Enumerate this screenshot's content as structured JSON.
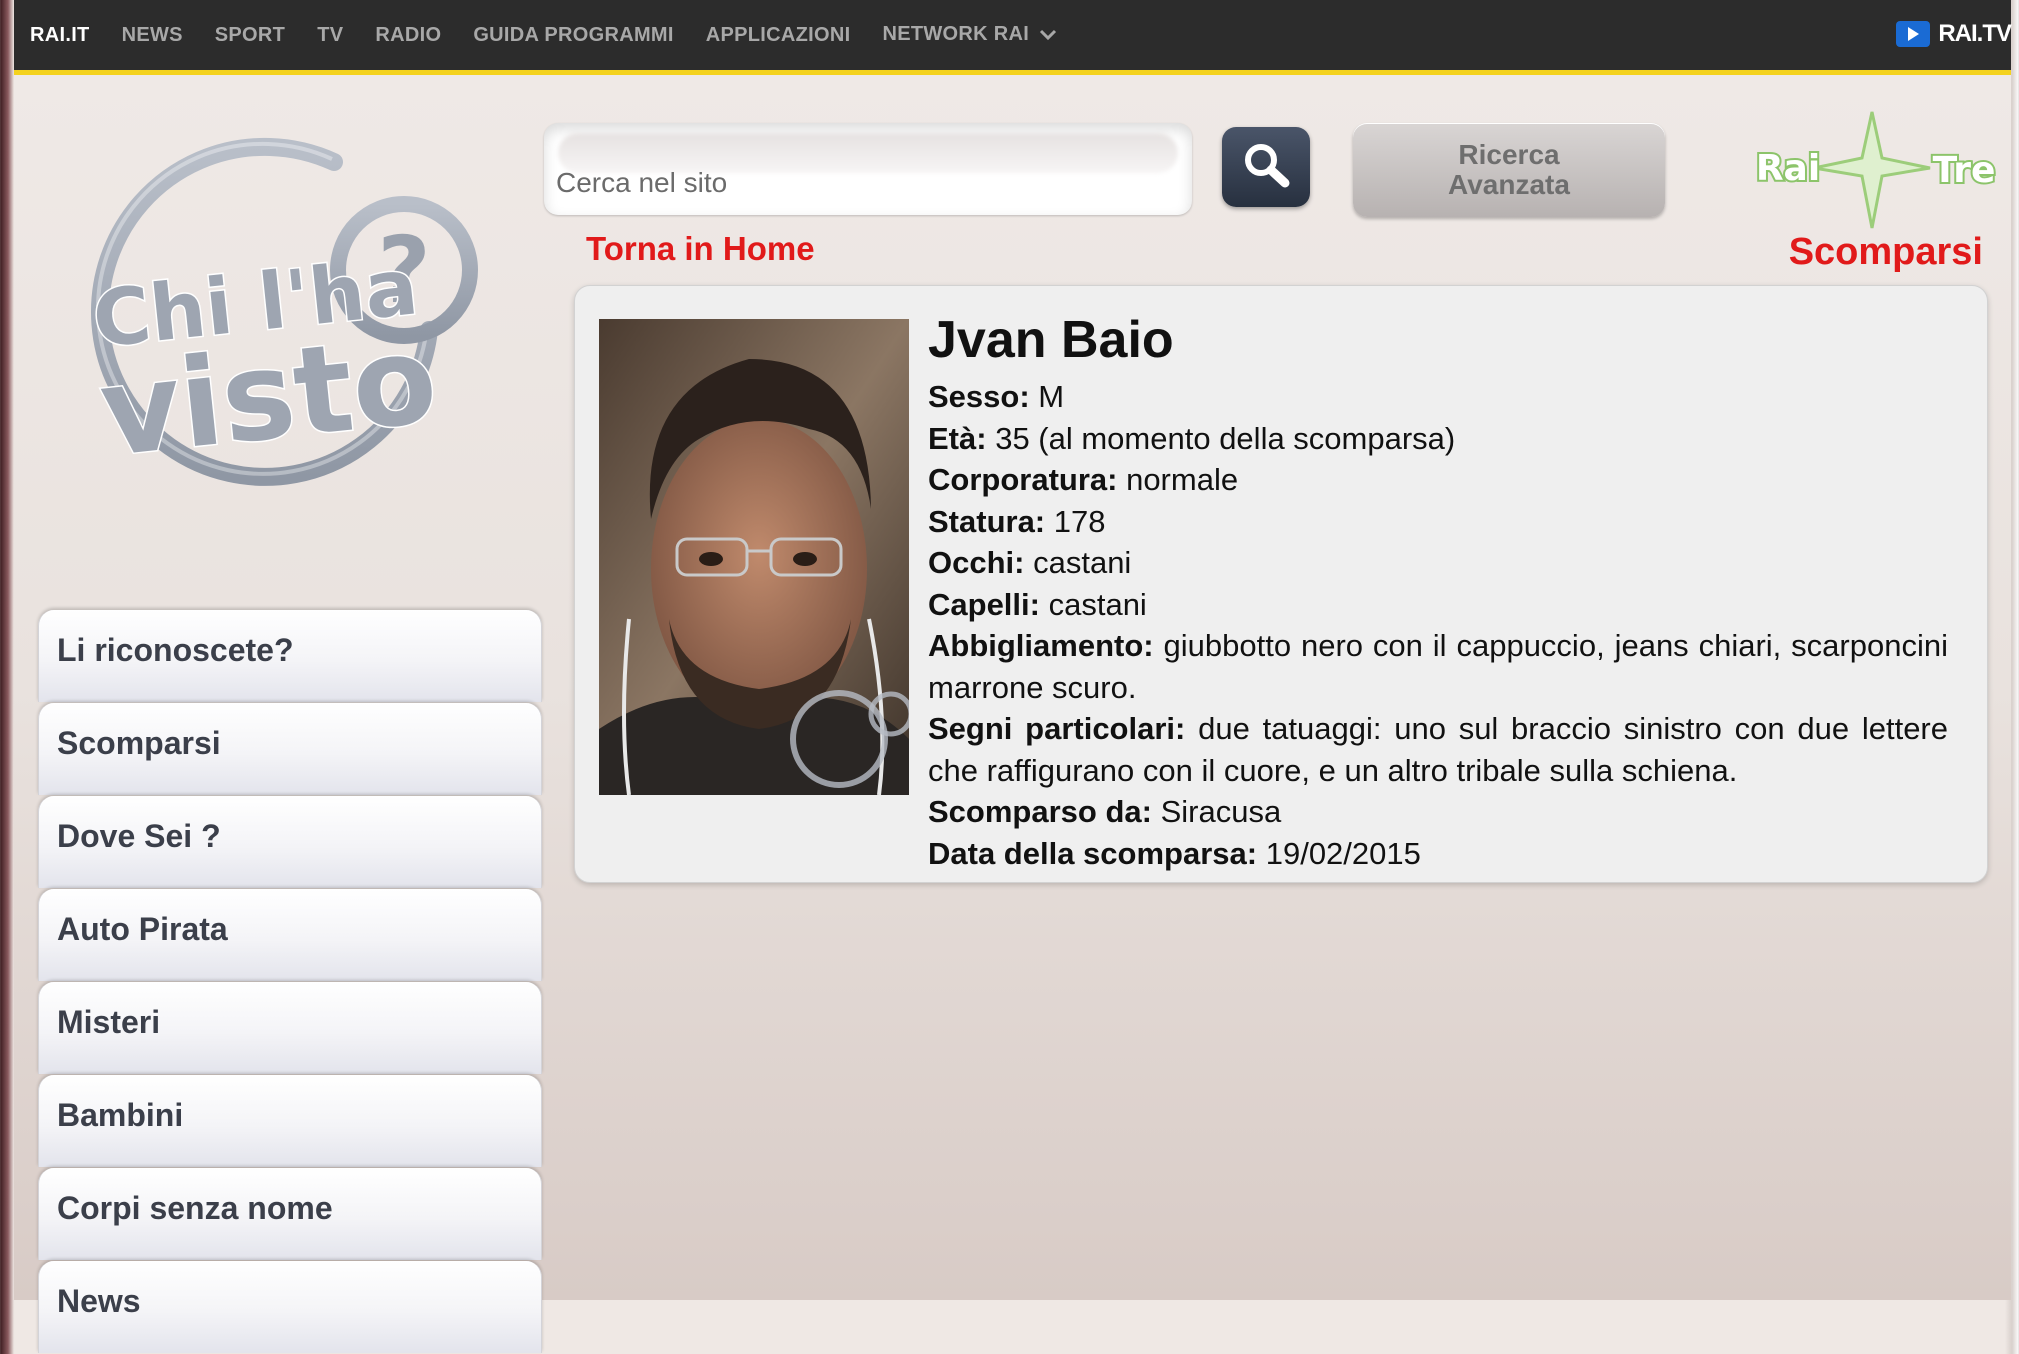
{
  "topbar": {
    "items": [
      "RAI.IT",
      "NEWS",
      "SPORT",
      "TV",
      "RADIO",
      "GUIDA PROGRAMMI",
      "APPLICAZIONI",
      "NETWORK RAI"
    ],
    "raitv_label": "RAI.TV",
    "accent_color": "#f4d21e"
  },
  "logo": {
    "line1": "Chi l'ha",
    "line2": "visto",
    "mark": "?"
  },
  "search": {
    "placeholder": "Cerca nel sito",
    "value": "",
    "advanced_label": "Ricerca\nAvanzata",
    "icon": "search-icon"
  },
  "channel_logo": {
    "left": "Rai",
    "right": "Tre"
  },
  "home_link": "Torna in Home",
  "section_title": "Scomparsi",
  "menu": {
    "items": [
      "Li riconoscete?",
      "Scomparsi",
      "Dove Sei ?",
      "Auto Pirata",
      "Misteri",
      "Bambini",
      "Corpi senza nome",
      "News"
    ]
  },
  "person": {
    "name": "Jvan Baio",
    "fields": [
      {
        "label": "Sesso:",
        "value": "M"
      },
      {
        "label": "Età:",
        "value": "35 (al momento della scomparsa)"
      },
      {
        "label": "Corporatura:",
        "value": "normale"
      },
      {
        "label": "Statura:",
        "value": "178"
      },
      {
        "label": "Occhi:",
        "value": "castani"
      },
      {
        "label": "Capelli:",
        "value": "castani"
      },
      {
        "label": "Abbigliamento:",
        "value": "giubbotto nero con il cappuccio, jeans chiari, scarponcini marrone scuro."
      },
      {
        "label": "Segni particolari:",
        "value": "due tatuaggi: uno sul braccio sinistro con due lettere che raffigurano con il cuore, e un altro tribale sulla schiena."
      },
      {
        "label": "Scomparso da:",
        "value": "Siracusa"
      },
      {
        "label": "Data della scomparsa:",
        "value": "19/02/2015"
      }
    ]
  },
  "colors": {
    "red_link": "#e11a1a",
    "menu_text": "#3b3f4a"
  }
}
